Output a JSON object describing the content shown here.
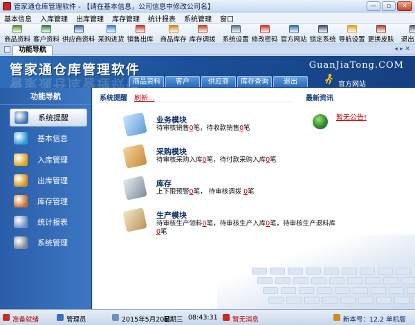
{
  "window": {
    "title": "管家通仓库管理软件 - 【请在基本信息，公司信息中修改公司名】",
    "buttons": [
      "—",
      "▫",
      "✕"
    ]
  },
  "menu": [
    "基本信息",
    "入库管理",
    "出库管理",
    "库存管理",
    "统计报表",
    "系统管理",
    "窗口"
  ],
  "toolbar": [
    {
      "label": "商品资料",
      "icon": "product-icon",
      "color": "#5a8a2d"
    },
    {
      "label": "客户资料",
      "icon": "customer-icon",
      "color": "#2e7c3f"
    },
    {
      "label": "供应商资料",
      "icon": "supplier-icon",
      "color": "#3a63a8"
    },
    {
      "label": "采购进货",
      "icon": "purchase-icon",
      "color": "#3b7fd4"
    },
    {
      "label": "销售出库",
      "icon": "sales-icon",
      "color": "#c0392b"
    },
    {
      "label": "商品库存",
      "icon": "stock-icon",
      "color": "#d08a1e"
    },
    {
      "label": "库存调拨",
      "icon": "transfer-icon",
      "color": "#b84a2f"
    },
    {
      "label": "系统设置",
      "icon": "settings-icon",
      "color": "#5a6f8c"
    },
    {
      "label": "修改密码",
      "icon": "password-icon",
      "color": "#c93b2b"
    },
    {
      "label": "官方网站",
      "icon": "website-icon",
      "color": "#2c6fb8"
    },
    {
      "label": "锁定系统",
      "icon": "lock-icon",
      "color": "#3e4f6a"
    },
    {
      "label": "导航设置",
      "icon": "navigation-icon",
      "color": "#e0a21e"
    },
    {
      "label": "更换皮肤",
      "icon": "skin-icon",
      "color": "#a8432e"
    },
    {
      "label": "退出系统",
      "icon": "exit-icon",
      "color": "#4c5a6e"
    }
  ],
  "tab": {
    "label": "功能导航"
  },
  "banner": {
    "brand": "管家通仓库管理软件",
    "site": "GuanJiaTong.COM",
    "tabs": [
      "商品资料",
      "客户",
      "供应商",
      "库存查询",
      "退出"
    ],
    "official": "官方网站"
  },
  "leftnav": {
    "header": "功能导航",
    "items": [
      {
        "label": "系统提醒",
        "icon": "alert-icon",
        "color": "#3c6fb5"
      },
      {
        "label": "基本信息",
        "icon": "basic-info-icon",
        "color": "#2d9ad8"
      },
      {
        "label": "入库管理",
        "icon": "inbound-icon",
        "color": "#e0a21e"
      },
      {
        "label": "出库管理",
        "icon": "outbound-icon",
        "color": "#d4911a"
      },
      {
        "label": "库存管理",
        "icon": "inventory-icon",
        "color": "#c9702c"
      },
      {
        "label": "统计报表",
        "icon": "report-icon",
        "color": "#6c8fc4"
      },
      {
        "label": "系统管理",
        "icon": "system-icon",
        "color": "#7d8896"
      }
    ]
  },
  "main": {
    "system_alert": "系统提醒",
    "refresh": "刷新...",
    "news_title": "最新资讯",
    "news_link": "暂无公告!",
    "modules": [
      {
        "title": "业务模块",
        "icon": "book-icon",
        "lines": [
          [
            {
              "t": "待审核销售"
            },
            {
              "t": "0",
              "h": true
            },
            {
              "t": "笔，待收款销售"
            },
            {
              "t": "0",
              "h": true
            },
            {
              "t": "笔"
            }
          ]
        ]
      },
      {
        "title": "采购模块",
        "icon": "box-icon",
        "lines": [
          [
            {
              "t": "待审核采购入库"
            },
            {
              "t": "0",
              "h": true
            },
            {
              "t": "笔，待付款采购入库"
            },
            {
              "t": "0",
              "h": true
            },
            {
              "t": "笔"
            }
          ]
        ]
      },
      {
        "title": "库存",
        "icon": "database-icon",
        "lines": [
          [
            {
              "t": "上下限预警"
            },
            {
              "t": "0",
              "h": true
            },
            {
              "t": "笔， 待审核调拨 "
            },
            {
              "t": "0",
              "h": true
            },
            {
              "t": "笔"
            }
          ]
        ]
      },
      {
        "title": "生产模块",
        "icon": "clipboard-icon",
        "lines": [
          [
            {
              "t": "待审核生产领料"
            },
            {
              "t": "0",
              "h": true
            },
            {
              "t": "笔，待审核生产入库"
            },
            {
              "t": "0",
              "h": true
            },
            {
              "t": "笔，待审核生产退料库"
            }
          ],
          [
            {
              "t": "0",
              "h": true
            },
            {
              "t": "笔"
            }
          ]
        ]
      }
    ]
  },
  "status": {
    "ready": "准备就绪",
    "user": "管理员",
    "date": "2015年5月20日",
    "weekday": "星期三",
    "time": "08:43:31",
    "message": "暂无消息",
    "version": "新本号：12.2 单机版"
  }
}
